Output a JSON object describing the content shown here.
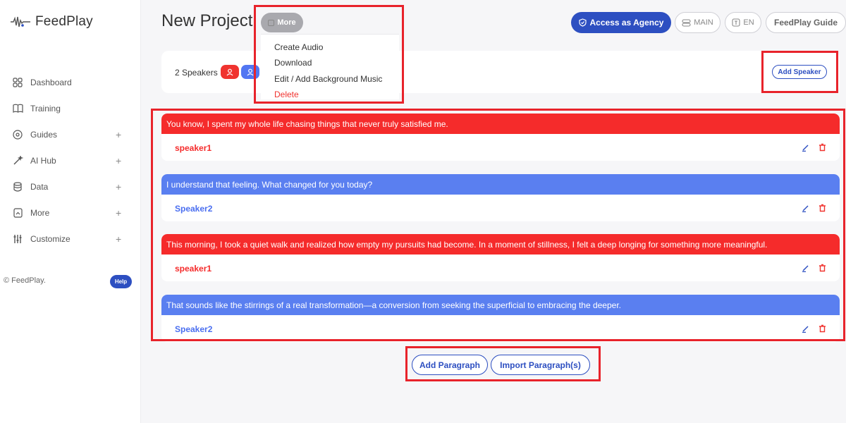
{
  "app": {
    "logo_text": "FeedPlay"
  },
  "sidebar": {
    "items": [
      {
        "label": "Dashboard",
        "icon": "grid-icon",
        "expandable": false
      },
      {
        "label": "Training",
        "icon": "book-icon",
        "expandable": false
      },
      {
        "label": "Guides",
        "icon": "compass-icon",
        "expandable": true
      },
      {
        "label": "AI Hub",
        "icon": "magic-wand-icon",
        "expandable": true
      },
      {
        "label": "Data",
        "icon": "database-icon",
        "expandable": true
      },
      {
        "label": "More",
        "icon": "box-icon",
        "expandable": true
      },
      {
        "label": "Customize",
        "icon": "sliders-icon",
        "expandable": true
      }
    ],
    "plus": "+",
    "copyright": "© FeedPlay.",
    "help_label": "Help"
  },
  "header": {
    "title": "New Project",
    "more_label": "More",
    "agency_label": "Access as Agency",
    "main_label": "MAIN",
    "lang_label": "EN",
    "guide_label": "FeedPlay Guide"
  },
  "dropdown": {
    "items": [
      "Create Audio",
      "Download",
      "Edit / Add Background Music",
      "Delete"
    ]
  },
  "speakers": {
    "count_label": "2 Speakers",
    "add_label": "Add Speaker"
  },
  "paragraphs": [
    {
      "text": "You know, I spent my whole life chasing things that never truly satisfied me.",
      "speaker": "speaker1",
      "color": "#f52b2b"
    },
    {
      "text": "I understand that feeling. What changed for you today?",
      "speaker": "Speaker2",
      "color": "#5a7ff0"
    },
    {
      "text": "This morning, I took a quiet walk and realized how empty my pursuits had become. In a moment of stillness, I felt a deep longing for something more meaningful.",
      "speaker": "speaker1",
      "color": "#f52b2b"
    },
    {
      "text": "That sounds like the stirrings of a real transformation—a conversion from seeking the superficial to embracing the deeper.",
      "speaker": "Speaker2",
      "color": "#5a7ff0"
    }
  ],
  "actions": {
    "add_paragraph": "Add Paragraph",
    "import_paragraphs": "Import Paragraph(s)"
  },
  "colors": {
    "accent": "#2d4fc1",
    "speaker1": "#f52b2b",
    "speaker2": "#5a7ff0",
    "highlight": "#e8232b"
  }
}
